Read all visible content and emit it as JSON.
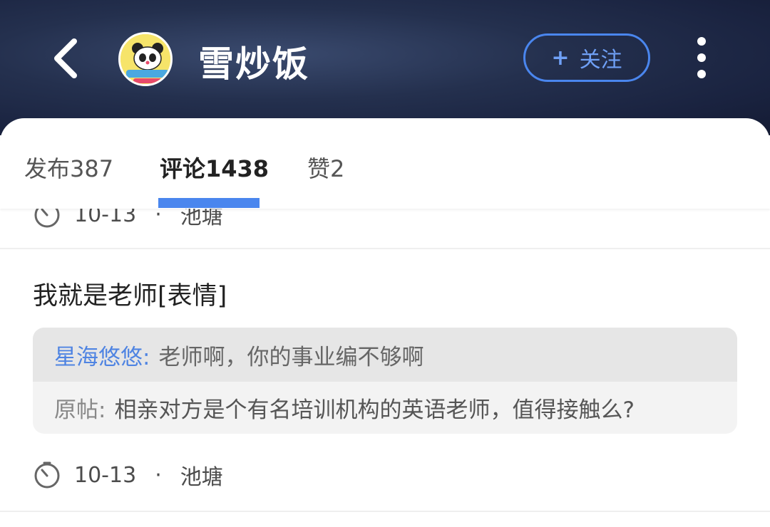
{
  "header": {
    "title": "雪炒饭",
    "follow_label": "关注",
    "follow_icon": "plus-icon",
    "back_icon": "chevron-left-icon",
    "more_icon": "more-vertical-icon",
    "avatar_icon": "panda-avatar"
  },
  "tabs": [
    {
      "label": "发布387",
      "active": false
    },
    {
      "label": "评论1438",
      "active": true
    },
    {
      "label": "赞2",
      "active": false
    }
  ],
  "feed": {
    "prev_item": {
      "date": "10-13",
      "location": "池塘"
    },
    "item": {
      "comment": "我就是老师[表情]",
      "reply_user": "星海悠悠:",
      "reply_text": "老师啊，你的事业编不够啊",
      "original_label": "原帖:",
      "original_text": "相亲对方是个有名培训机构的英语老师，值得接触么?",
      "date": "10-13",
      "location": "池塘"
    },
    "separator": "·"
  },
  "colors": {
    "accent": "#4a86ee",
    "header_bg": "#1f2a48",
    "reply_user": "#4f84e2"
  }
}
